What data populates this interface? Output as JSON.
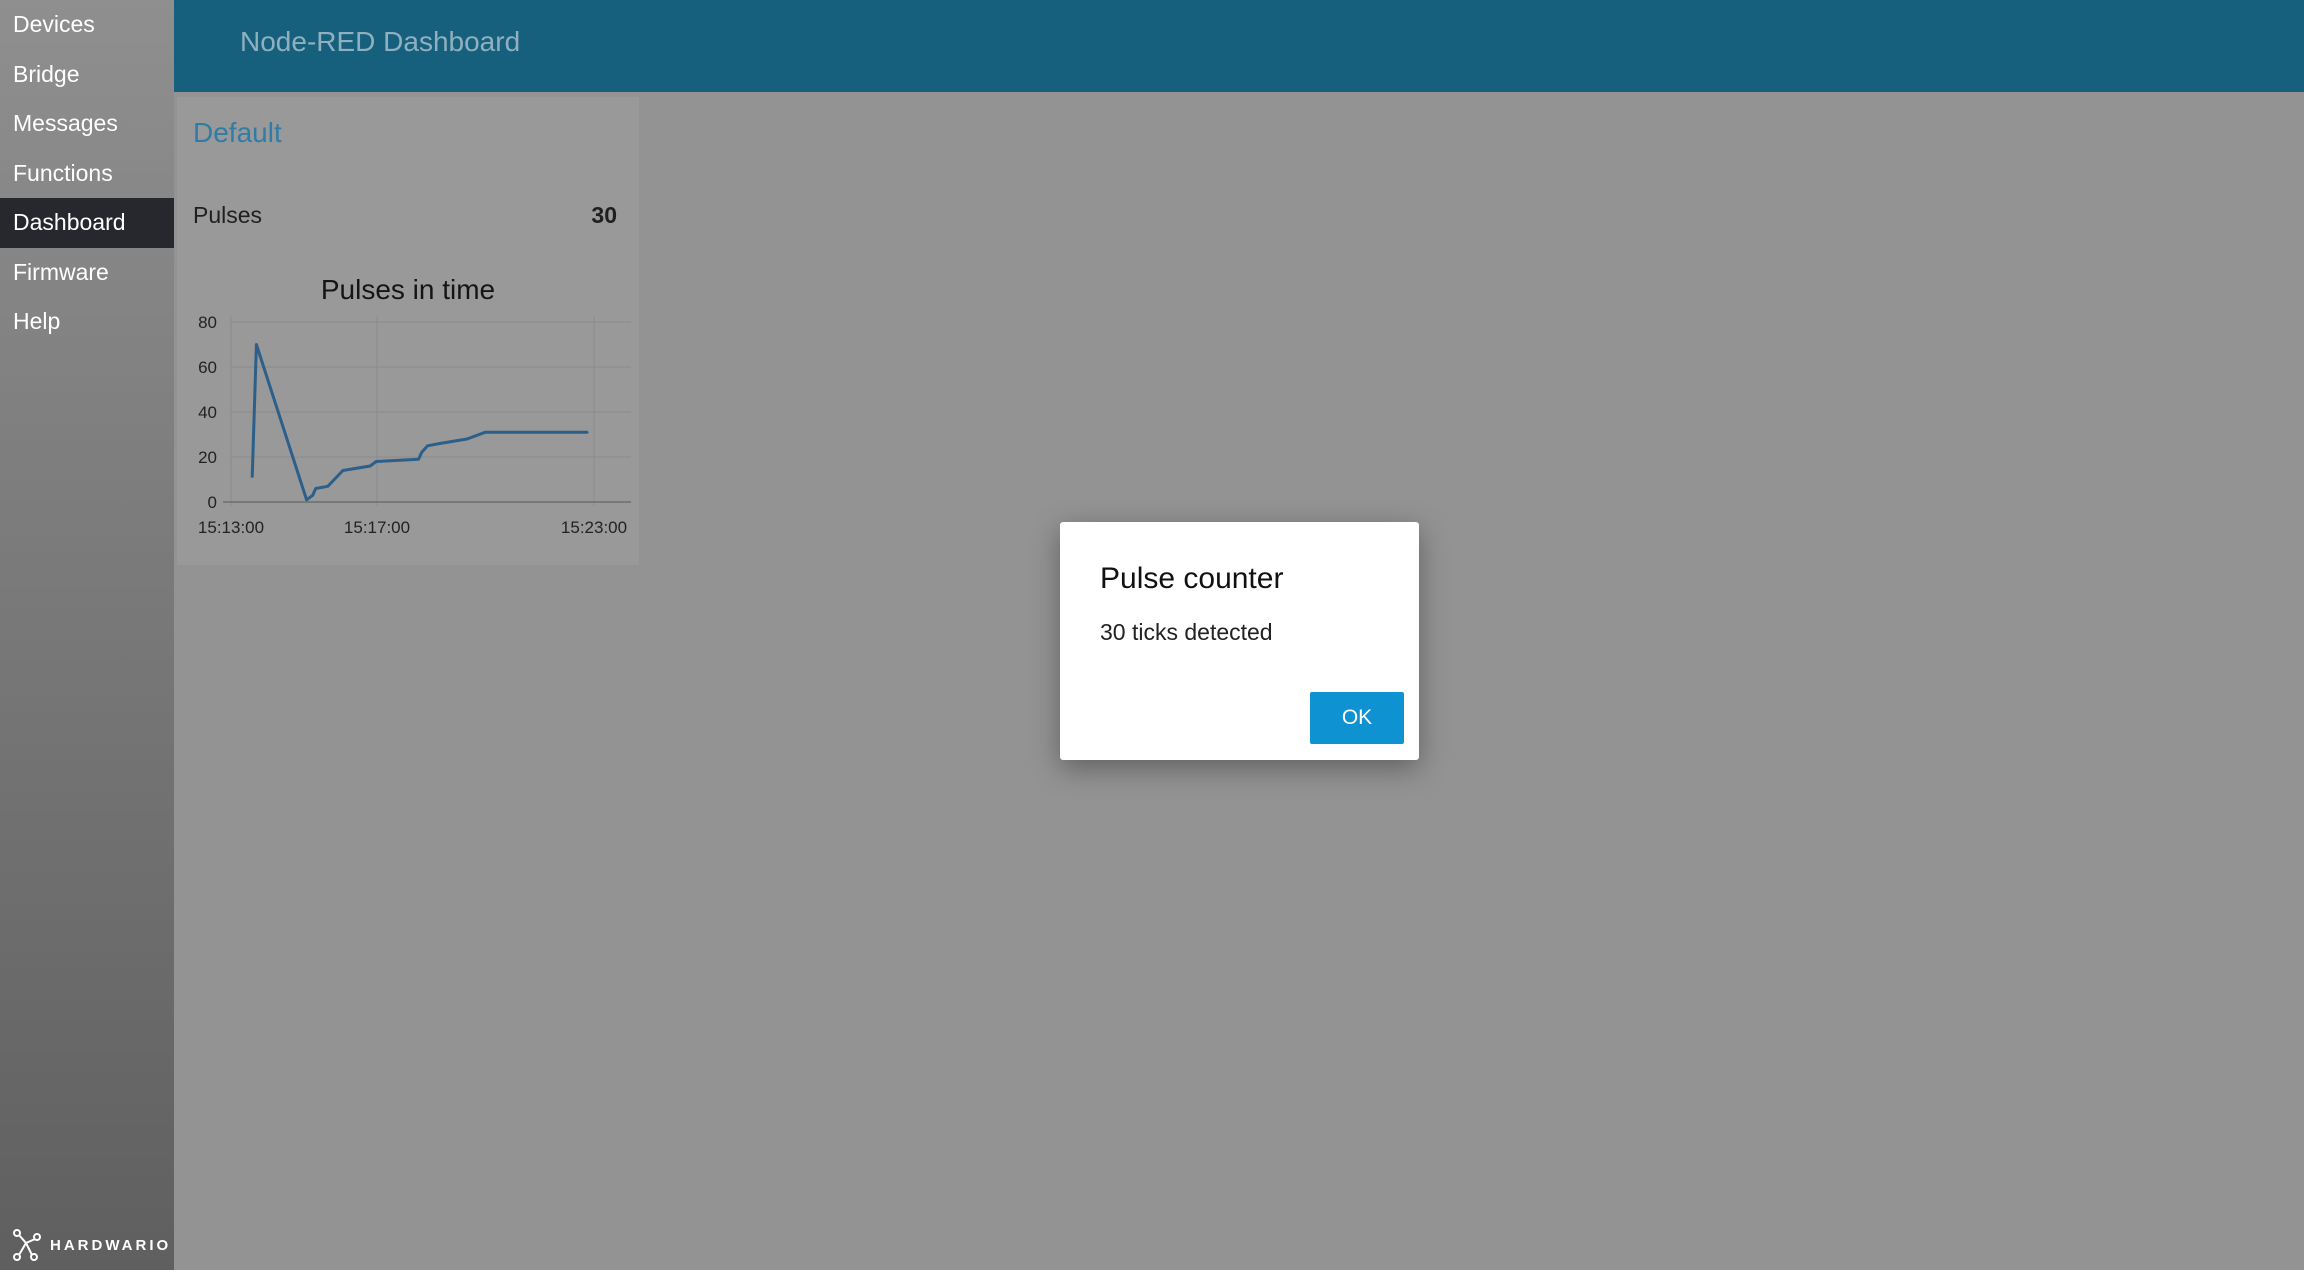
{
  "sidebar": {
    "items": [
      {
        "label": "Devices",
        "active": false
      },
      {
        "label": "Bridge",
        "active": false
      },
      {
        "label": "Messages",
        "active": false
      },
      {
        "label": "Functions",
        "active": false
      },
      {
        "label": "Dashboard",
        "active": true
      },
      {
        "label": "Firmware",
        "active": false
      },
      {
        "label": "Help",
        "active": false
      }
    ],
    "brand": {
      "text": "HARDWARIO",
      "icon": "hardwario-logo-icon"
    }
  },
  "header": {
    "title": "Node-RED Dashboard"
  },
  "group": {
    "title": "Default",
    "pulses": {
      "label": "Pulses",
      "value": "30"
    }
  },
  "chart_data": {
    "type": "line",
    "title": "Pulses in time",
    "xlabel": "",
    "ylabel": "",
    "x_ticks": [
      "15:13:00",
      "15:17:00",
      "15:23:00"
    ],
    "y_ticks": [
      0,
      20,
      40,
      60,
      80
    ],
    "ylim": [
      0,
      80
    ],
    "grid": true,
    "series": [
      {
        "color": "#2c5f8a",
        "points": [
          [
            "15:13:35",
            11
          ],
          [
            "15:13:42",
            70
          ],
          [
            "15:15:05",
            1
          ],
          [
            "15:15:15",
            3
          ],
          [
            "15:15:20",
            6
          ],
          [
            "15:15:40",
            7
          ],
          [
            "15:16:05",
            14
          ],
          [
            "15:16:50",
            16
          ],
          [
            "15:17:00",
            18
          ],
          [
            "15:18:10",
            19
          ],
          [
            "15:18:15",
            22
          ],
          [
            "15:18:25",
            25
          ],
          [
            "15:18:45",
            26
          ],
          [
            "15:19:30",
            28
          ],
          [
            "15:20:00",
            31
          ],
          [
            "15:22:50",
            31
          ]
        ]
      }
    ]
  },
  "dialog": {
    "title": "Pulse counter",
    "message": "30 ticks detected",
    "ok_label": "OK"
  }
}
